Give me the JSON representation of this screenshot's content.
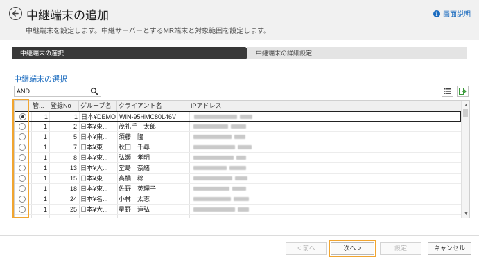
{
  "header": {
    "title": "中継端末の追加",
    "subtitle": "中継端末を設定します。中継サーバーとするMR端末と対象範囲を設定します。",
    "help_label": "画面説明"
  },
  "steps": [
    "中継端末の選択",
    "中継端末の詳細設定"
  ],
  "section_title": "中継端末の選択",
  "search": {
    "value": "AND",
    "placeholder": ""
  },
  "table": {
    "columns": [
      "",
      "管...",
      "登録No",
      "グループ名",
      "クライアント名",
      "IPアドレス"
    ],
    "rows": [
      {
        "selected": true,
        "kanri": "1",
        "reg": "1",
        "group": "日本¥DEMO",
        "client": "WIN-95HMC80L46V"
      },
      {
        "selected": false,
        "kanri": "1",
        "reg": "2",
        "group": "日本¥東...",
        "client": "茂礼手　太郎"
      },
      {
        "selected": false,
        "kanri": "1",
        "reg": "5",
        "group": "日本¥東...",
        "client": "須藤　隆"
      },
      {
        "selected": false,
        "kanri": "1",
        "reg": "7",
        "group": "日本¥東...",
        "client": "秋田　千尋"
      },
      {
        "selected": false,
        "kanri": "1",
        "reg": "8",
        "group": "日本¥東...",
        "client": "弘瀬　孝明"
      },
      {
        "selected": false,
        "kanri": "1",
        "reg": "13",
        "group": "日本¥大...",
        "client": "堂島　奈緒"
      },
      {
        "selected": false,
        "kanri": "1",
        "reg": "15",
        "group": "日本¥東...",
        "client": "高橋　稔"
      },
      {
        "selected": false,
        "kanri": "1",
        "reg": "18",
        "group": "日本¥東...",
        "client": "佐野　英理子"
      },
      {
        "selected": false,
        "kanri": "1",
        "reg": "24",
        "group": "日本¥名...",
        "client": "小林　太志"
      },
      {
        "selected": false,
        "kanri": "1",
        "reg": "25",
        "group": "日本¥大...",
        "client": "星野　道弘"
      }
    ]
  },
  "footer": {
    "prev_label": "< 前へ",
    "next_label": "次へ >",
    "settings_label": "設定",
    "cancel_label": "キャンセル"
  },
  "colors": {
    "accent": "#1a6bbf",
    "highlight": "#f1a530",
    "step_active": "#3a3a3a"
  }
}
